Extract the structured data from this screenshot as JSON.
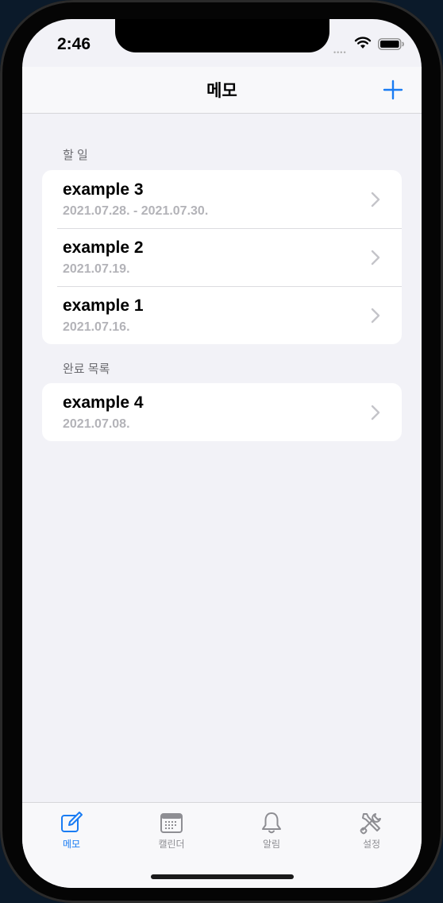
{
  "status_bar": {
    "time": "2:46"
  },
  "navbar": {
    "title": "메모",
    "add_icon": "plus-icon"
  },
  "sections": [
    {
      "header": "할 일",
      "items": [
        {
          "title": "example 3",
          "date": "2021.07.28. - 2021.07.30."
        },
        {
          "title": "example 2",
          "date": "2021.07.19."
        },
        {
          "title": "example 1",
          "date": "2021.07.16."
        }
      ]
    },
    {
      "header": "완료 목록",
      "items": [
        {
          "title": "example 4",
          "date": "2021.07.08."
        }
      ]
    }
  ],
  "tabbar": {
    "tabs": [
      {
        "label": "메모",
        "icon": "memo-edit-icon",
        "active": true
      },
      {
        "label": "캘린더",
        "icon": "calendar-icon",
        "active": false
      },
      {
        "label": "알림",
        "icon": "bell-icon",
        "active": false
      },
      {
        "label": "설정",
        "icon": "tools-icon",
        "active": false
      }
    ]
  },
  "colors": {
    "accent": "#1a7cf3",
    "background": "#f2f2f7",
    "secondary_text": "#b3b3b8",
    "inactive_tab": "#8e8e93"
  }
}
